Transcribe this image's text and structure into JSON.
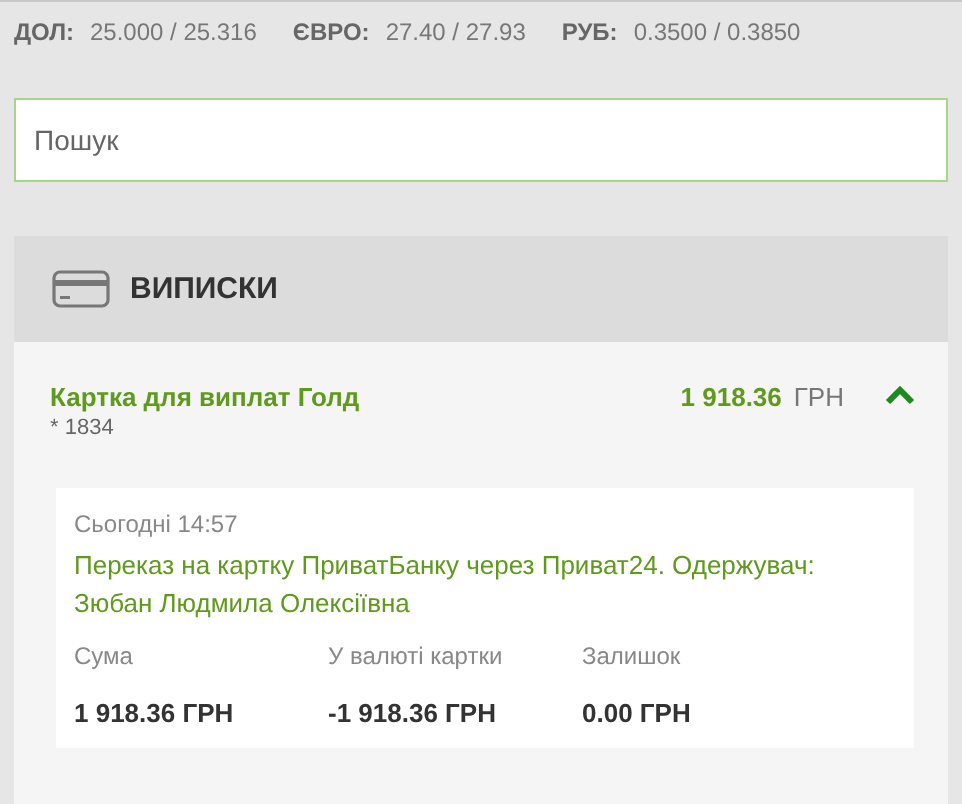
{
  "rates": [
    {
      "label": "ДОЛ:",
      "value": "25.000 / 25.316"
    },
    {
      "label": "ЄВРО:",
      "value": "27.40 / 27.93"
    },
    {
      "label": "РУБ:",
      "value": "0.3500 / 0.3850"
    }
  ],
  "search": {
    "placeholder": "Пошук"
  },
  "statements": {
    "title": "ВИПИСКИ",
    "account": {
      "name": "Картка для виплат Голд",
      "number": "* 1834",
      "amount": "1 918.36",
      "currency": "ГРН",
      "expanded": true
    },
    "transactions": [
      {
        "date": "Сьогодні 14:57",
        "description": "Переказ на картку ПриватБанку через Приват24. Одержувач: Зюбан Людмила Олексіївна",
        "columns": [
          {
            "label": "Сума",
            "value": "1 918.36 ГРН"
          },
          {
            "label": "У валюті картки",
            "value": "-1 918.36 ГРН"
          },
          {
            "label": "Залишок",
            "value": "0.00 ГРН"
          }
        ]
      }
    ]
  }
}
